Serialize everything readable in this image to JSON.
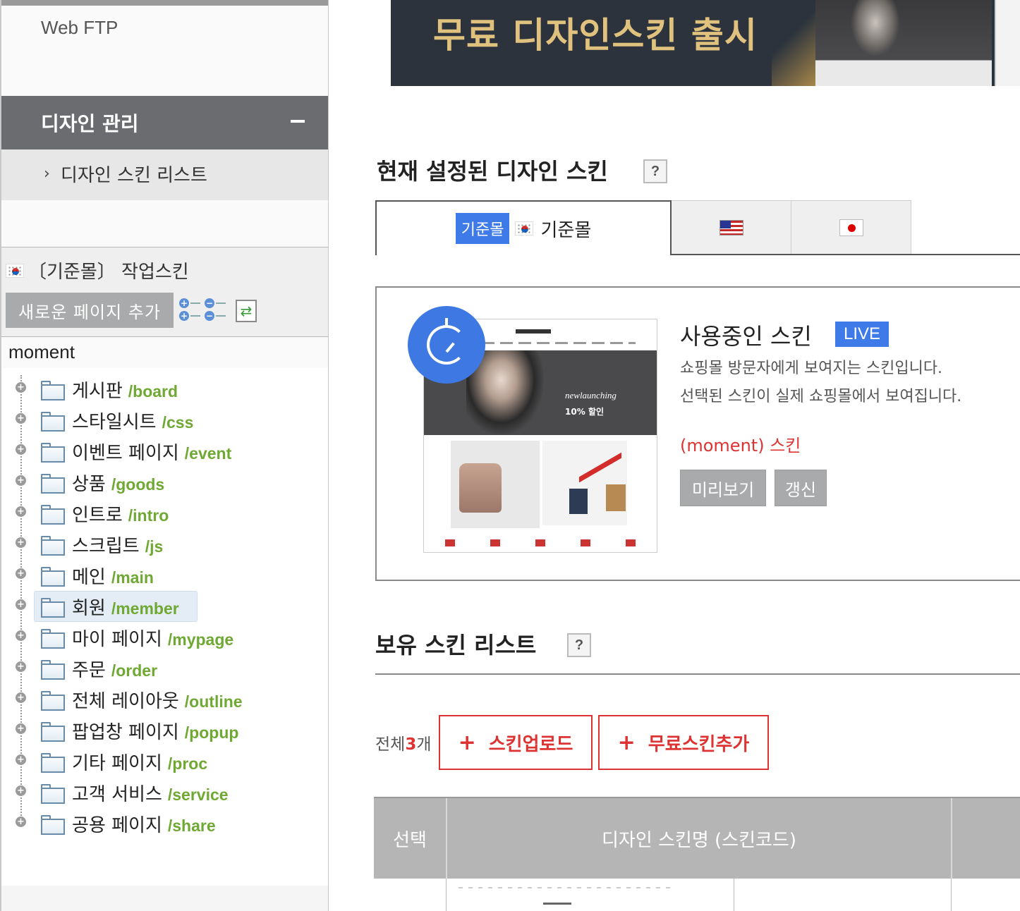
{
  "sidebar": {
    "web_ftp": "Web FTP",
    "design_mgmt": {
      "title": "디자인 관리",
      "toggle": "−"
    },
    "skin_list_link": {
      "arrow": "›",
      "label": "디자인 스킨 리스트"
    },
    "work_skin": {
      "title": "〔기준몰〕 작업스킨",
      "new_page_button": "새로운 페이지 추가",
      "refresh_icon": "⇄"
    },
    "tree": {
      "root": "moment",
      "items": [
        {
          "name": "게시판",
          "path": "/board"
        },
        {
          "name": "스타일시트",
          "path": "/css"
        },
        {
          "name": "이벤트 페이지",
          "path": "/event"
        },
        {
          "name": "상품",
          "path": "/goods"
        },
        {
          "name": "인트로",
          "path": "/intro"
        },
        {
          "name": "스크립트",
          "path": "/js"
        },
        {
          "name": "메인",
          "path": "/main"
        },
        {
          "name": "회원",
          "path": "/member"
        },
        {
          "name": "마이 페이지",
          "path": "/mypage"
        },
        {
          "name": "주문",
          "path": "/order"
        },
        {
          "name": "전체 레이아웃",
          "path": "/outline"
        },
        {
          "name": "팝업창 페이지",
          "path": "/popup"
        },
        {
          "name": "기타 페이지",
          "path": "/proc"
        },
        {
          "name": "고객 서비스",
          "path": "/service"
        },
        {
          "name": "공용 페이지",
          "path": "/share"
        }
      ],
      "selected": "/member"
    }
  },
  "banner": {
    "text": "무료 디자인스킨 출시"
  },
  "current_skin": {
    "section_title": "현재 설정된 디자인 스킨",
    "help": "?",
    "tabs": {
      "base_badge": "기준몰",
      "base_label": "기준몰"
    },
    "card": {
      "title": "사용중인 스킨",
      "live": "LIVE",
      "desc1": "쇼핑몰 방문자에게 보여지는 스킨입니다.",
      "desc2": "선택된 스킨이 실제 쇼핑몰에서 보여집니다.",
      "skin_code": "(moment) 스킨",
      "preview_button": "미리보기",
      "refresh_button": "갱신"
    }
  },
  "owned_skins": {
    "section_title": "보유 스킨 리스트",
    "help": "?",
    "total_prefix": "전체",
    "total_count": "3",
    "total_suffix": "개",
    "upload_button": "스킨업로드",
    "add_free_button": "무료스킨추가",
    "plus": "+",
    "table": {
      "col_select": "선택",
      "col_name": "디자인 스킨명 (스킨코드)"
    }
  },
  "colors": {
    "accent_blue": "#3f7be8",
    "accent_red": "#dd3333",
    "path_green": "#6fa832"
  }
}
